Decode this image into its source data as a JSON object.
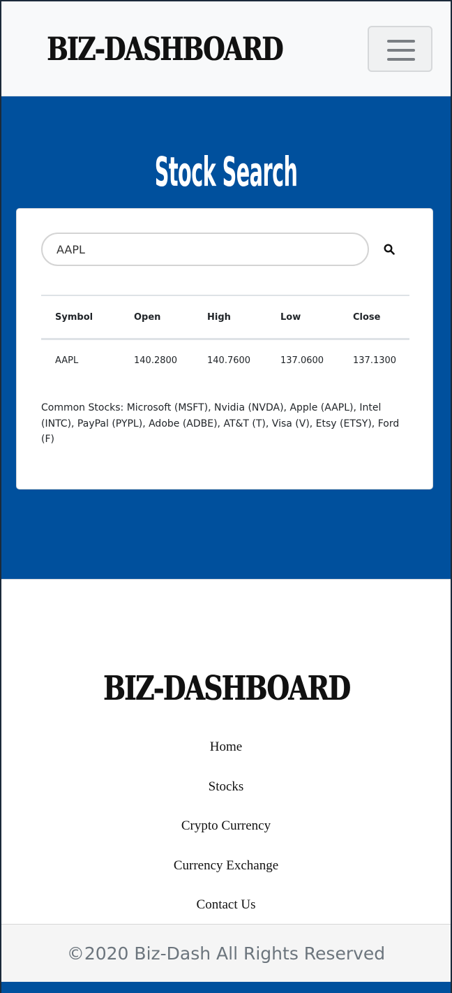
{
  "navbar": {
    "brand": "BIZ-DASHBOARD",
    "menu_icon": "hamburger-menu-icon"
  },
  "hero": {
    "title": "Stock Search"
  },
  "search": {
    "value": "AAPL",
    "icon": "search-icon"
  },
  "table": {
    "headers": [
      "Symbol",
      "Open",
      "High",
      "Low",
      "Close"
    ],
    "rows": [
      [
        "AAPL",
        "140.2800",
        "140.7600",
        "137.0600",
        "137.1300"
      ]
    ]
  },
  "common_stocks": "Common Stocks: Microsoft (MSFT), Nvidia (NVDA), Apple (AAPL), Intel (INTC), PayPal (PYPL), Adobe (ADBE), AT&T (T), Visa (V), Etsy (ETSY), Ford (F)",
  "footer": {
    "brand": "BIZ-DASHBOARD",
    "links": [
      "Home",
      "Stocks",
      "Crypto Currency",
      "Currency Exchange",
      "Contact Us"
    ],
    "copyright": "©2020 Biz-Dash All Rights Reserved"
  },
  "colors": {
    "primary": "#00509d",
    "navbar_bg": "#f8f9fa"
  }
}
